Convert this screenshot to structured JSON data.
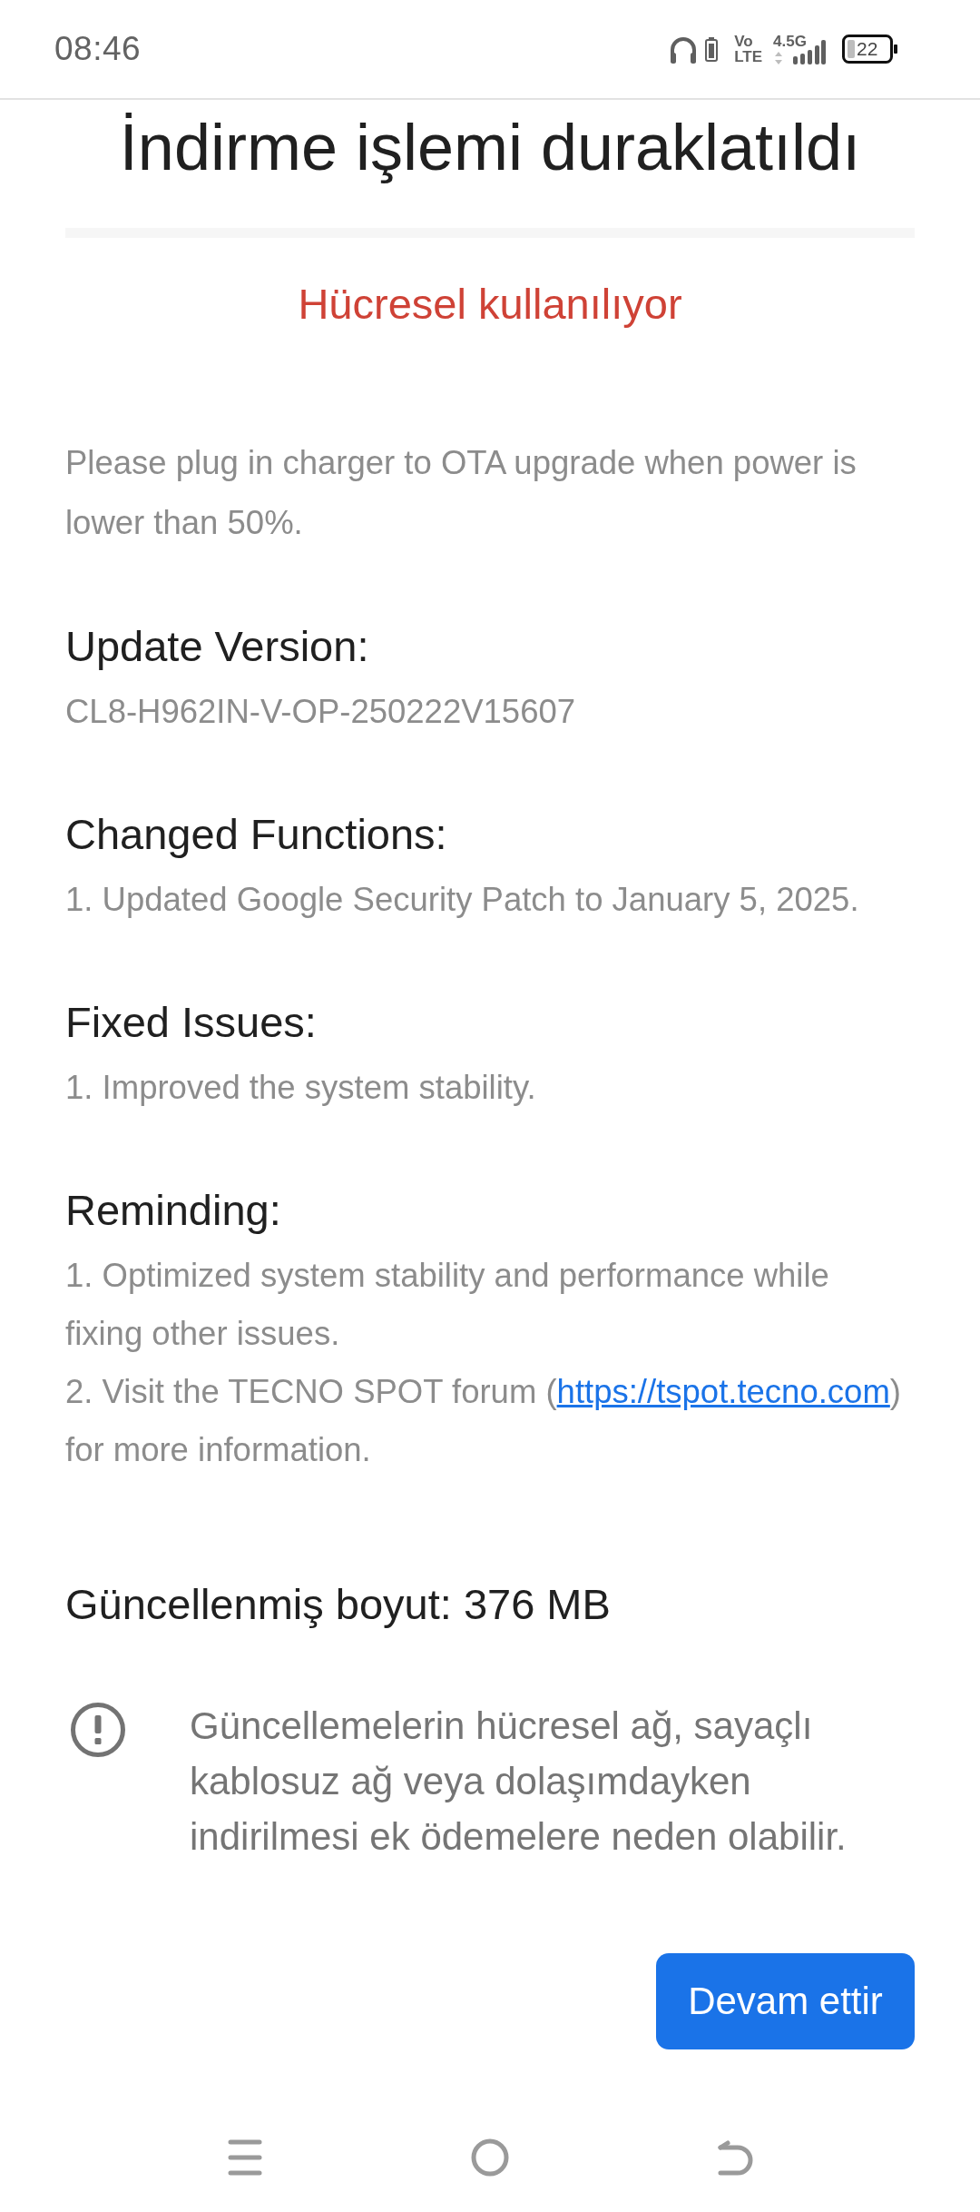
{
  "status_bar": {
    "time": "08:46",
    "volte_top": "Vo",
    "volte_bottom": "LTE",
    "network_type": "4.5G",
    "battery": "22"
  },
  "title": "İndirme işlemi duraklatıldı",
  "progress": {
    "level": 0
  },
  "connection_status": "Hücresel kullanılıyor",
  "notice": "Please plug in charger to OTA upgrade when power is lower than 50%.",
  "sections": [
    {
      "heading": "Update Version:",
      "lines": [
        {
          "text": "CL8-H962IN-V-OP-250222V15607"
        }
      ]
    },
    {
      "heading": "Changed Functions:",
      "lines": [
        {
          "text": "1. Updated Google Security Patch to January 5, 2025."
        }
      ]
    },
    {
      "heading": "Fixed Issues:",
      "lines": [
        {
          "text": "1. Improved the system stability."
        }
      ]
    },
    {
      "heading": "Reminding:",
      "lines": [
        {
          "text": "1. Optimized system stability and performance while fixing other issues."
        },
        {
          "text": "2. Visit the TECNO SPOT forum (",
          "link": "https://tspot.tecno.com",
          "text_after": ") for more information."
        }
      ]
    }
  ],
  "update_size": "Güncellenmiş boyut: 376 MB",
  "warning": "Güncellemelerin hücresel ağ, sayaçlı kablosuz ağ veya dolaşımdayken indirilmesi ek ödemelere neden olabilir.",
  "continue_button": "Devam ettir"
}
